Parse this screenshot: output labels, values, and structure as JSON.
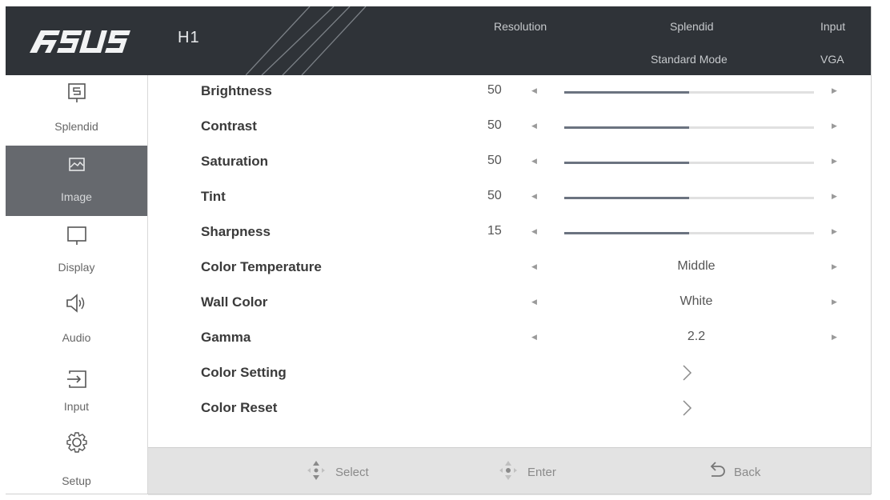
{
  "header": {
    "logo_icon": "asus-logo",
    "model": "H1",
    "resolution_label": "Resolution",
    "splendid_label": "Splendid",
    "splendid_value": "Standard Mode",
    "input_label": "Input",
    "input_value": "VGA"
  },
  "sidebar": {
    "items": [
      {
        "label": "Splendid",
        "icon": "splendid-icon"
      },
      {
        "label": "Image",
        "icon": "image-icon",
        "active": true
      },
      {
        "label": "Display",
        "icon": "display-icon"
      },
      {
        "label": "Audio",
        "icon": "speaker-icon"
      },
      {
        "label": "Input",
        "icon": "input-icon"
      },
      {
        "label": "Setup",
        "icon": "gear-icon"
      }
    ]
  },
  "settings": {
    "brightness": {
      "label": "Brightness",
      "value": "50",
      "level": 0.5
    },
    "contrast": {
      "label": "Contrast",
      "value": "50",
      "level": 0.5
    },
    "saturation": {
      "label": "Saturation",
      "value": "50",
      "level": 0.5
    },
    "tint": {
      "label": "Tint",
      "value": "50",
      "level": 0.5
    },
    "sharpness": {
      "label": "Sharpness",
      "value": "15",
      "level": 0.5
    },
    "color_temperature": {
      "label": "Color Temperature",
      "value": "Middle"
    },
    "wall_color": {
      "label": "Wall Color",
      "value": "White"
    },
    "gamma": {
      "label": "Gamma",
      "value": "2.2"
    },
    "color_setting": {
      "label": "Color Setting"
    },
    "color_reset": {
      "label": "Color Reset"
    }
  },
  "footer": {
    "select_label": "Select",
    "enter_label": "Enter",
    "back_label": "Back"
  },
  "colors": {
    "header_bg": "#2f3338",
    "active_bg": "#66696e",
    "slider_fill": "#6b7380",
    "footer_bg": "#e3e3e3"
  }
}
